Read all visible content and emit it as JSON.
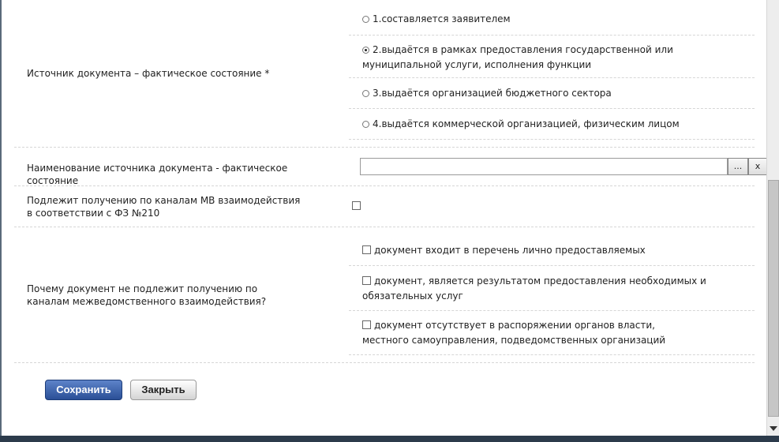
{
  "source_field": {
    "label": "Источник документа – фактическое состояние *",
    "options": [
      {
        "label": "1.составляется заявителем",
        "checked": false
      },
      {
        "label": "2.выдаётся в рамках предоставления государственной или муниципальной услуги, исполнения функции",
        "checked": true
      },
      {
        "label": "3.выдаётся организацией бюджетного сектора",
        "checked": false
      },
      {
        "label": "4.выдаётся коммерческой организацией, физическим лицом",
        "checked": false
      }
    ]
  },
  "source_name_field": {
    "label": "Наименование источника документа - фактическое состояние",
    "value": "",
    "browse_label": "...",
    "clear_label": "x"
  },
  "interaction_field": {
    "label": "Подлежит получению по каналам МВ взаимодействия в соответствии с ФЗ №210",
    "checked": false
  },
  "reason_field": {
    "label": "Почему документ не подлежит получению по каналам межведомственного взаимодействия?",
    "options": [
      {
        "label": "документ входит в перечень лично предоставляемых",
        "checked": false
      },
      {
        "label": "документ, является результатом предоставления необходимых и обязательных услуг",
        "checked": false
      },
      {
        "label": "документ отсутствует в распоряжении органов власти, местного самоуправления, подведомственных организаций",
        "checked": false
      }
    ]
  },
  "actions": {
    "save_label": "Сохранить",
    "close_label": "Закрыть"
  }
}
